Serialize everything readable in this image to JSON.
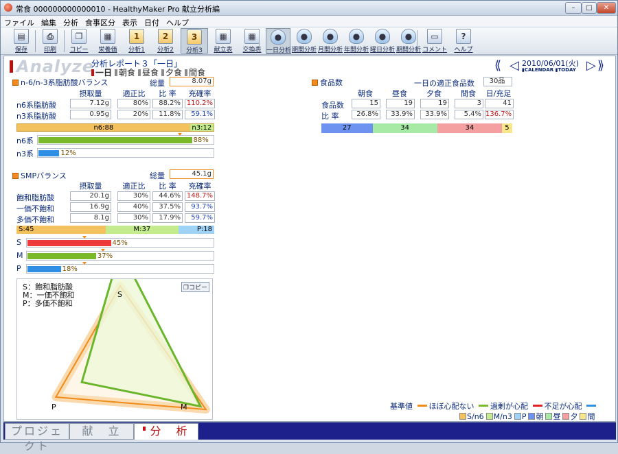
{
  "window": {
    "title": "常食 000000000000010 - HealthyMaker Pro 献立分析編",
    "minimize": "–",
    "maximize": "□",
    "close": "✕"
  },
  "menu": [
    "ファイル",
    "編集",
    "分析",
    "食事区分",
    "表示",
    "日付",
    "ヘルプ"
  ],
  "toolbar": [
    {
      "label": "保存",
      "icon": "save-icon",
      "glyph": "▤"
    },
    {
      "label": "印刷",
      "icon": "print-icon",
      "glyph": "⎙"
    },
    {
      "label": "コピー",
      "icon": "copy-icon",
      "glyph": "❐"
    },
    {
      "label": "栄養価",
      "icon": "nutrition-icon",
      "glyph": "▦"
    },
    {
      "label": "分析1",
      "icon": "analysis1-icon",
      "glyph": "1"
    },
    {
      "label": "分析2",
      "icon": "analysis2-icon",
      "glyph": "2"
    },
    {
      "label": "分析3",
      "icon": "analysis3-icon",
      "glyph": "3"
    },
    {
      "label": "献立表",
      "icon": "menu-table-icon",
      "glyph": "▦"
    },
    {
      "label": "交換表",
      "icon": "exchange-table-icon",
      "glyph": "▦"
    },
    {
      "label": "一日分析",
      "icon": "day-analysis-icon",
      "glyph": "●"
    },
    {
      "label": "期間分析",
      "icon": "period-analysis-icon",
      "glyph": "●"
    },
    {
      "label": "月間分析",
      "icon": "month-analysis-icon",
      "glyph": "●"
    },
    {
      "label": "年間分析",
      "icon": "year-analysis-icon",
      "glyph": "●"
    },
    {
      "label": "曜日分析",
      "icon": "weekday-analysis-icon",
      "glyph": "●"
    },
    {
      "label": "期間分析",
      "icon": "period2-analysis-icon",
      "glyph": "●"
    },
    {
      "label": "コメント",
      "icon": "comment-icon",
      "glyph": "▭"
    },
    {
      "label": "ヘルプ",
      "icon": "help-icon",
      "glyph": "?"
    }
  ],
  "header": {
    "logo": "Analyze",
    "report_title": "分析レポート３「一日」",
    "meals": [
      "一日",
      "朝食",
      "昼食",
      "夕食",
      "間食"
    ],
    "active_meal": "一日",
    "date": "2010/06/01(火)",
    "calendar": "CALENDAR",
    "today": "TODAY"
  },
  "n6n3": {
    "title": "n-6/n-3系脂肪酸バランス",
    "total_label": "総量",
    "total": "8.07g",
    "cols": [
      "摂取量",
      "適正比",
      "比  率",
      "充確率"
    ],
    "rows": [
      {
        "name": "n6系脂肪酸",
        "intake": "7.12g",
        "ideal": "80%",
        "ratio": "88.2%",
        "fulfil": "110.2%",
        "fulfil_color": "red"
      },
      {
        "name": "n3系脂肪酸",
        "intake": "0.95g",
        "ideal": "20%",
        "ratio": "11.8%",
        "fulfil": "59.1%",
        "fulfil_color": "blue"
      }
    ],
    "ratio_left": "n6:88",
    "ratio_right": "n3:12",
    "ratio_left_pct": 88,
    "bars": [
      {
        "name": "n6系",
        "pct": 88,
        "label": "88%",
        "color": "#7ab92a"
      },
      {
        "name": "n3系",
        "pct": 12,
        "label": "12%",
        "color": "#2f8fe4"
      }
    ]
  },
  "smp": {
    "title": "SMPバランス",
    "total_label": "総量",
    "total": "45.1g",
    "cols": [
      "摂取量",
      "適正比",
      "比  率",
      "充確率"
    ],
    "rows": [
      {
        "name": "飽和脂肪酸",
        "intake": "20.1g",
        "ideal": "30%",
        "ratio": "44.6%",
        "fulfil": "148.7%",
        "fulfil_color": "red"
      },
      {
        "name": "一価不飽和",
        "intake": "16.9g",
        "ideal": "40%",
        "ratio": "37.5%",
        "fulfil": "93.7%",
        "fulfil_color": "blue"
      },
      {
        "name": "多価不飽和",
        "intake": "8.1g",
        "ideal": "30%",
        "ratio": "17.9%",
        "fulfil": "59.7%",
        "fulfil_color": "blue"
      }
    ],
    "ratio": [
      {
        "label": "S:45",
        "pct": 45,
        "color": "#f3c15e"
      },
      {
        "label": "M:37",
        "pct": 37,
        "color": "#c4ec8e"
      },
      {
        "label": "P:18",
        "pct": 18,
        "color": "#9fd2f7"
      }
    ],
    "bars": [
      {
        "name": "S",
        "pct": 45,
        "label": "45%",
        "color": "#ef3a3a"
      },
      {
        "name": "M",
        "pct": 37,
        "label": "37%",
        "color": "#7ab92a"
      },
      {
        "name": "P",
        "pct": 18,
        "label": "18%",
        "color": "#2f8fe4"
      }
    ]
  },
  "radar": {
    "legend": [
      "S：飽和脂肪酸",
      "M：一価不飽和",
      "P：多価不飽和"
    ],
    "copy": "コピー",
    "axis_labels": {
      "S": "S",
      "M": "M",
      "P": "P"
    },
    "values": {
      "S": 44.6,
      "M": 37.5,
      "P": 17.9
    },
    "ideal": {
      "S": 30,
      "M": 40,
      "P": 30
    }
  },
  "food": {
    "title": "食品数",
    "daily_label": "一日の適正食品数",
    "daily_value": "30品",
    "cols": [
      "朝食",
      "昼食",
      "夕食",
      "間食",
      "日/充足"
    ],
    "rows": [
      {
        "name": "食品数",
        "values": [
          "15",
          "19",
          "19",
          "3",
          "41"
        ],
        "last_color": ""
      },
      {
        "name": "比  率",
        "values": [
          "26.8%",
          "33.9%",
          "33.9%",
          "5.4%",
          "136.7%"
        ],
        "last_color": "red"
      }
    ],
    "bar": [
      {
        "label": "27",
        "pct": 26.8,
        "color": "#6d92f0"
      },
      {
        "label": "34",
        "pct": 33.9,
        "color": "#a6eaa6"
      },
      {
        "label": "34",
        "pct": 33.9,
        "color": "#f4a0a0"
      },
      {
        "label": "5",
        "pct": 5.4,
        "color": "#f7e68a"
      }
    ]
  },
  "legend": {
    "base_label": "基準値",
    "items": [
      "ほぼ心配ない",
      "過剰が心配",
      "不足が心配"
    ],
    "line_colors": [
      "#f08a18",
      "#7ab92a",
      "#e02020",
      "#2f8fe4"
    ],
    "swatches": [
      {
        "label": "S/n6",
        "color": "#f3c15e"
      },
      {
        "label": "M/n3",
        "color": "#c4ec8e"
      },
      {
        "label": "P",
        "color": "#9fd2f7"
      },
      {
        "label": "朝",
        "color": "#6d92f0"
      },
      {
        "label": "昼",
        "color": "#a6eaa6"
      },
      {
        "label": "夕",
        "color": "#f4a0a0"
      },
      {
        "label": "間",
        "color": "#f7e68a"
      }
    ]
  },
  "tabs": {
    "project": "プロジェクト",
    "menu": "献　立",
    "analysis": "分　析"
  }
}
